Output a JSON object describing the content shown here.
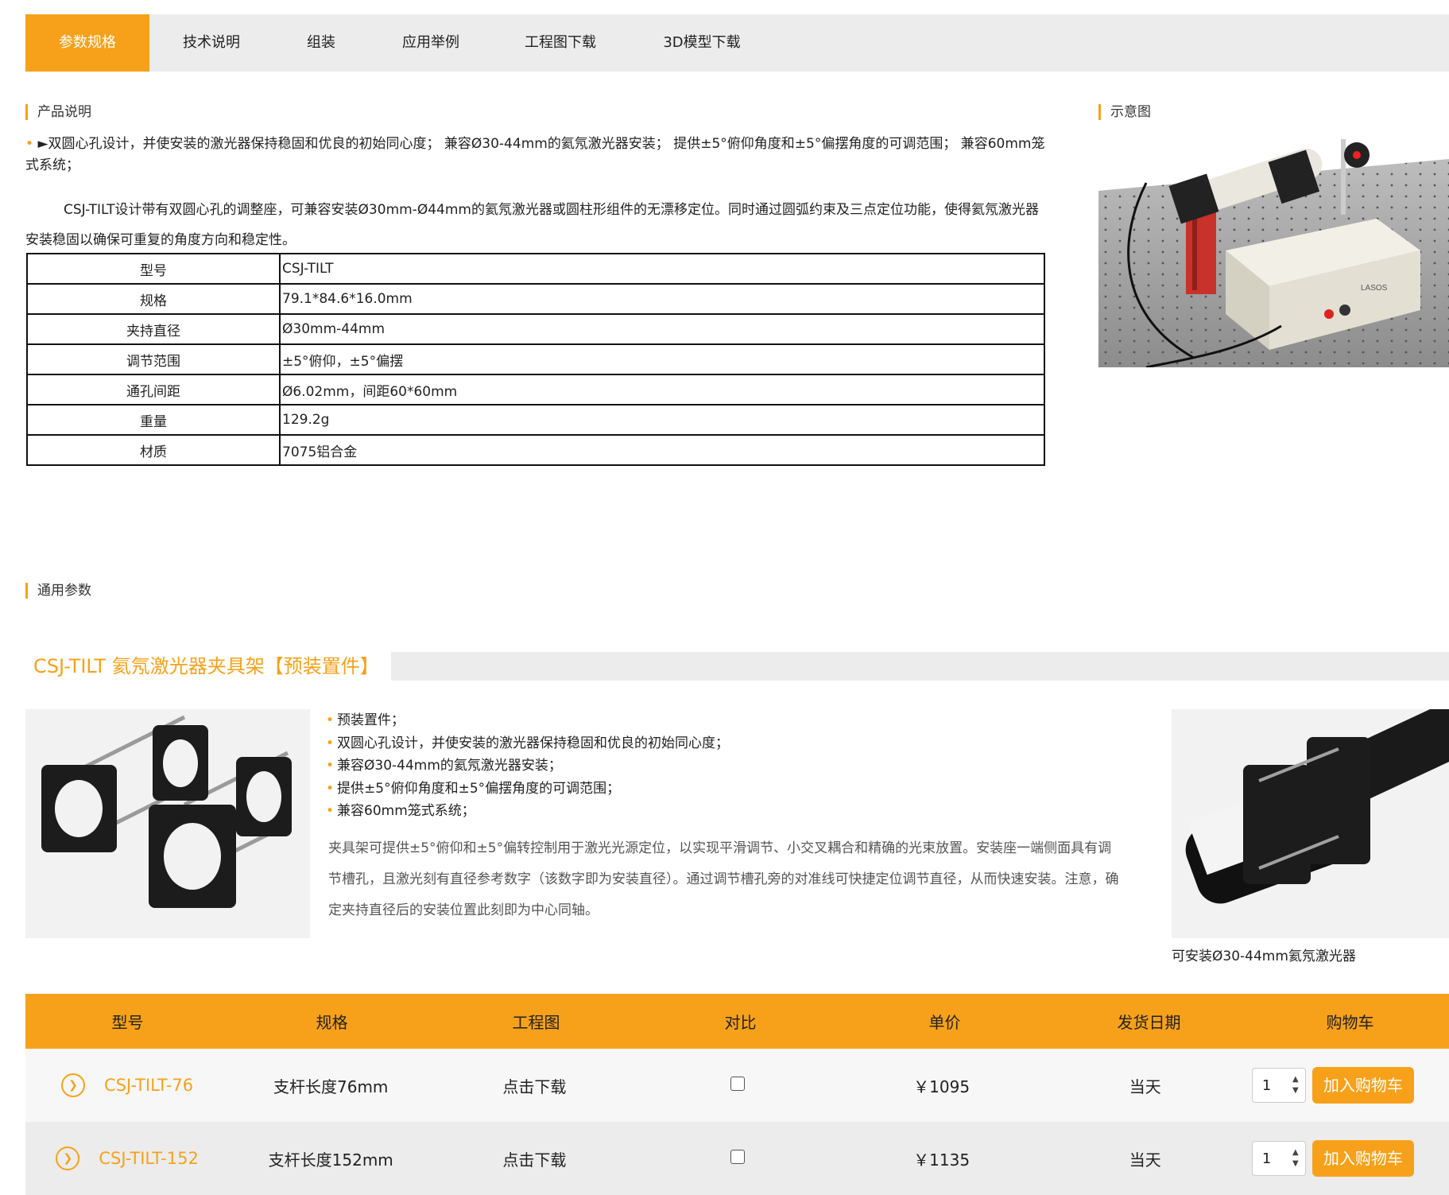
{
  "tabs": [
    {
      "label": "参数规格",
      "active": true
    },
    {
      "label": "技术说明"
    },
    {
      "label": "组装"
    },
    {
      "label": "应用举例"
    },
    {
      "label": "工程图下载"
    },
    {
      "label": "3D模型下载"
    }
  ],
  "product_desc": {
    "heading": "产品说明",
    "bullet_mark": "•",
    "line1": "►双圆心孔设计，并使安装的激光器保持稳固和优良的初始同心度； 兼容Ø30-44mm的氦氖激光器安装； 提供±5°俯仰角度和±5°偏摆角度的可调范围； 兼容60mm笼式系统；",
    "paragraph": "CSJ-TILT设计带有双圆心孔的调整座，可兼容安装Ø30mm-Ø44mm的氦氖激光器或圆柱形组件的无漂移定位。同时通过圆弧约束及三点定位功能，使得氦氖激光器安装稳固以确保可重复的角度方向和稳定性。"
  },
  "spec_table": [
    {
      "key": "型号",
      "value": "CSJ-TILT"
    },
    {
      "key": "规格",
      "value": "79.1*84.6*16.0mm"
    },
    {
      "key": "夹持直径",
      "value": "Ø30mm-44mm"
    },
    {
      "key": "调节范围",
      "value": "±5°俯仰，±5°偏摆"
    },
    {
      "key": "通孔间距",
      "value": "Ø6.02mm，间距60*60mm"
    },
    {
      "key": "重量",
      "value": "129.2g"
    },
    {
      "key": "材质",
      "value": "7075铝合金"
    }
  ],
  "illustration": {
    "heading": "示意图",
    "device_label": "LASOS"
  },
  "general": {
    "heading": "通用参数"
  },
  "product": {
    "title": "CSJ-TILT 氦氖激光器夹具架【预装置件】",
    "features": [
      "预装置件；",
      "双圆心孔设计，并使安装的激光器保持稳固和优良的初始同心度；",
      "兼容Ø30-44mm的氦氖激光器安装；",
      "提供±5°俯仰角度和±5°偏摆角度的可调范围；",
      "兼容60mm笼式系统；"
    ],
    "paragraph": "夹具架可提供±5°俯仰和±5°偏转控制用于激光光源定位，以实现平滑调节、小交叉耦合和精确的光束放置。安装座一端侧面具有调节槽孔，且激光刻有直径参考数字（该数字即为安装直径）。通过调节槽孔旁的对准线可快捷定位调节直径，从而快速安装。注意，确定夹持直径后的安装位置此刻即为中心同轴。",
    "caption": "可安装Ø30-44mm氦氖激光器"
  },
  "table": {
    "headers": [
      "型号",
      "规格",
      "工程图",
      "对比",
      "单价",
      "发货日期",
      "购物车"
    ],
    "rows": [
      {
        "model": "CSJ-TILT-76",
        "spec": "支杆长度76mm",
        "drawing": "点击下载",
        "price": "￥1095",
        "ship": "当天",
        "qty": "1",
        "add": "加入购物车"
      },
      {
        "model": "CSJ-TILT-152",
        "spec": "支杆长度152mm",
        "drawing": "点击下载",
        "price": "￥1135",
        "ship": "当天",
        "qty": "1",
        "add": "加入购物车"
      }
    ]
  },
  "colors": {
    "accent": "#f7a11a",
    "tab_bg": "#ececec"
  },
  "icons": {
    "row_arrow": "chevron-right-circle-icon",
    "spinner": "up-down-arrows-icon"
  }
}
